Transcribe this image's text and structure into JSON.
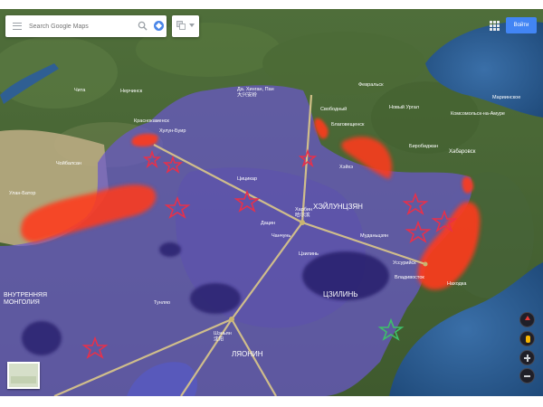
{
  "search": {
    "placeholder": "Search Google Maps"
  },
  "header": {
    "signin_label": "Войти"
  },
  "map": {
    "country_labels": [
      "ВНУТРЕННЯЯ\nМОНГОЛИЯ",
      "ХЭЙЛУНЦЗЯН",
      "ЦЗИЛИНЬ",
      "ЛЯОНИН"
    ],
    "city_labels": [
      "Да. Хинган, Пан\n大兴安岭",
      "Чита",
      "Нерчинск",
      "Февральск",
      "Свободный",
      "Благовещенск",
      "Новый Ургал",
      "Комсомольск-на-Амуре",
      "Мариинское",
      "Хабаровск",
      "Биробиджан",
      "Краснокаменск",
      "Хэйхэ",
      "Уссурийск",
      "Находка",
      "Владивосток",
      "Харбин\n哈尔滨",
      "Муданьцзян",
      "Цзилинь",
      "Чанчунь",
      "Шэньян\n沈阳",
      "Улан-Батор",
      "Чойбалсан",
      "Цицикар",
      "Хулун-Буир",
      "Дацин",
      "Тунляо"
    ]
  },
  "icons": {
    "menu": "menu-icon",
    "search": "search-icon",
    "directions": "directions-icon",
    "layers": "layers-icon",
    "apps": "apps-icon",
    "compass": "compass-icon",
    "pegman": "pegman-icon",
    "zoom_in": "zoom-in-icon",
    "zoom_out": "zoom-out-icon",
    "star": "star-icon"
  },
  "colors": {
    "overlay_purple": "#6a58cc",
    "dark_blob": "#2a2270",
    "red_zone": "#ff3a1a",
    "route_line": "#d6c38a",
    "star_red": "#e8304a",
    "star_green": "#3fbf6a",
    "signin_blue": "#4285f4"
  }
}
